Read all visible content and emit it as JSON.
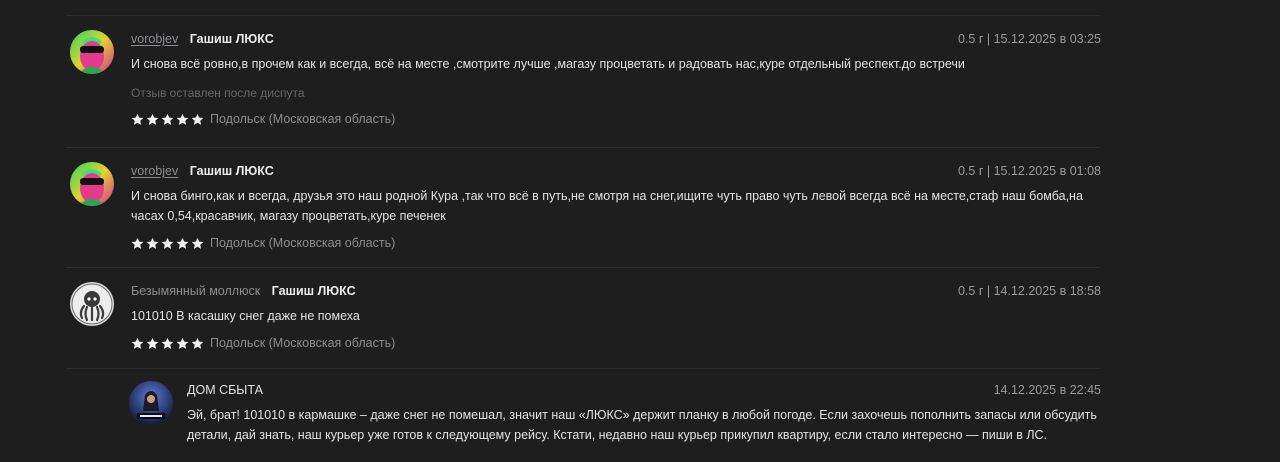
{
  "reviews": [
    {
      "author": "vorobjev",
      "product": "Гашиш ЛЮКС",
      "meta": "0.5 г | 15.12.2025 в 03:25",
      "text": "И снова всё ровно,в прочем как и всегда, всё на месте ,смотрите лучше ,магазу процветать и радовать нас,куре отдельный респект.до встречи",
      "note": "Отзыв оставлен после диспута",
      "location": "Подольск (Московская область)",
      "rating": 5
    },
    {
      "author": "vorobjev",
      "product": "Гашиш ЛЮКС",
      "meta": "0.5 г | 15.12.2025 в 01:08",
      "text": "И снова бинго,как и всегда, друзья это наш родной Кура ,так что всё в путь,не смотря на снег,ищите чуть право чуть левой всегда всё на месте,стаф наш бомба,на часах 0,54,красавчик, магазу процветать,куре печенек",
      "location": "Подольск (Московская область)",
      "rating": 5
    },
    {
      "author": "Безымянный моллюск",
      "product": "Гашиш ЛЮКС",
      "meta": "0.5 г | 14.12.2025 в 18:58",
      "text": "101010 В касашку снег даже не помеха",
      "location": "Подольск (Московская область)",
      "rating": 5
    }
  ],
  "reply": {
    "author": "ДОМ СБЫТА",
    "meta": "14.12.2025 в 22:45",
    "text": "Эй, брат! 101010 в кармашке – даже снег не помешал, значит наш «ЛЮКС» держит планку в любой погоде. Если захочешь пополнить запасы или обсудить детали, дай знать, наш курьер уже готов к следующему рейсу. Кстати, недавно наш курьер прикупил квартиру, если стало интересно — пиши в ЛС."
  },
  "icons": {
    "star": "star-icon",
    "avatar_1": "neon-face-avatar",
    "avatar_3": "octopus-avatar",
    "avatar_reply": "shop-logo-avatar"
  },
  "colors": {
    "background": "#1e1e1f",
    "divider": "#2c2c2e",
    "star": "#f2f2f2",
    "muted": "#8d8d91"
  }
}
